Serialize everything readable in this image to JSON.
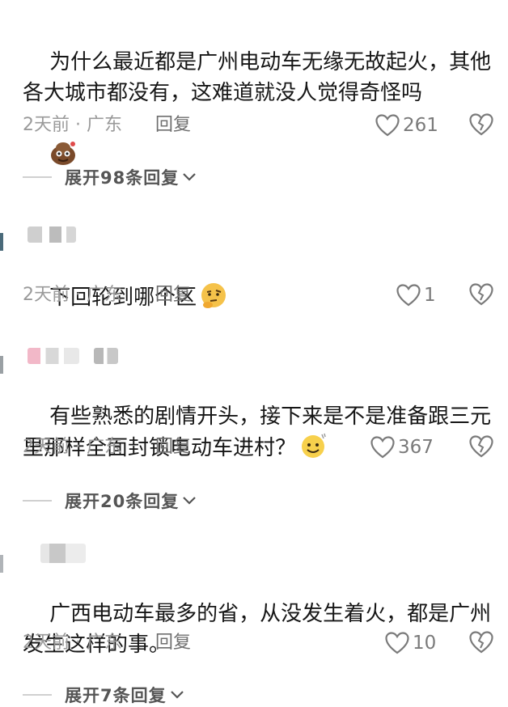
{
  "comments": [
    {
      "text": "为什么最近都是广州电动车无缘无故起火，其他各大城市都没有，这难道就没人觉得奇怪吗",
      "emoji": "poop-face-emoji",
      "meta": "2天前 · 广东",
      "reply_label": "回复",
      "likes": "261",
      "expand_label": "展开98条回复"
    },
    {
      "text": "下回轮到哪个区",
      "emoji": "thinking-face-emoji",
      "meta": "2天前 · 广东",
      "reply_label": "回复",
      "likes": "1"
    },
    {
      "text": "有些熟悉的剧情开头，接下来是不是准备跟三元里那样全面封锁电动车进村？",
      "emoji": "smile-sweat-emoji",
      "meta": "2天前 · 广东",
      "reply_label": "回复",
      "likes": "367",
      "expand_label": "展开20条回复"
    },
    {
      "text": "广西电动车最多的省，从没发生着火，都是广州发生这样的事。",
      "meta": "2天前 · 广东",
      "reply_label": "回复",
      "likes": "10",
      "expand_label": "展开7条回复"
    }
  ],
  "icons": {
    "like": "heart-outline-icon",
    "dislike": "broken-heart-icon",
    "expand": "chevron-down-icon"
  },
  "colors": {
    "meta": "#9a9a9a",
    "reply": "#6f6f6f",
    "expand": "#555555"
  }
}
